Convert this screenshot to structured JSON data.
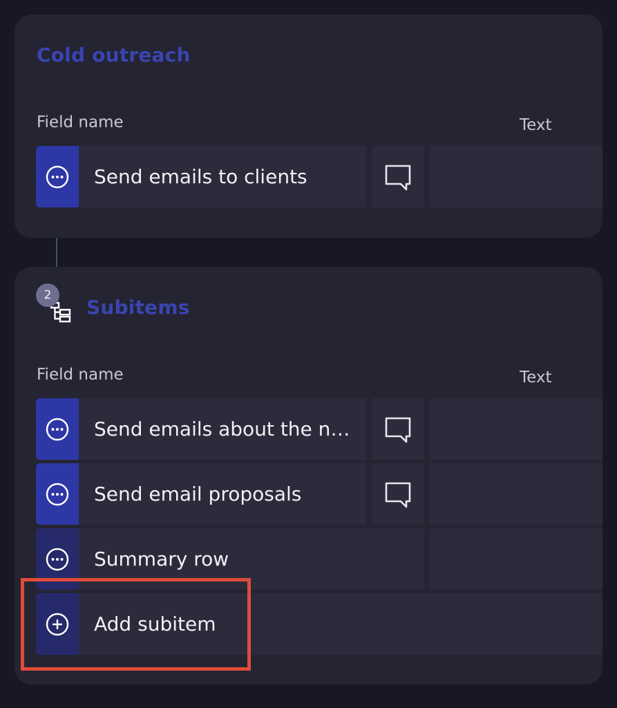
{
  "groups": [
    {
      "title": "Cold outreach",
      "columns": {
        "field": "Field name",
        "text": "Text"
      },
      "rows": [
        {
          "name": "Send emails to clients",
          "has_comment": true
        }
      ]
    }
  ],
  "subitems": {
    "title": "Subitems",
    "count_badge": "2",
    "columns": {
      "field": "Field name",
      "text": "Text"
    },
    "rows": [
      {
        "name": "Send emails about the n…",
        "has_comment": true
      },
      {
        "name": "Send email proposals",
        "has_comment": true
      },
      {
        "name": "Summary row",
        "has_comment": false
      }
    ],
    "add_label": "Add subitem"
  },
  "colors": {
    "background": "#181824",
    "card": "#242432",
    "accent": "#2e37a6",
    "group_title": "#3a44b0",
    "highlight": "#e04b3a"
  },
  "icons": [
    "more-options-icon",
    "comment-icon",
    "subitems-icon",
    "add-circle-icon"
  ]
}
